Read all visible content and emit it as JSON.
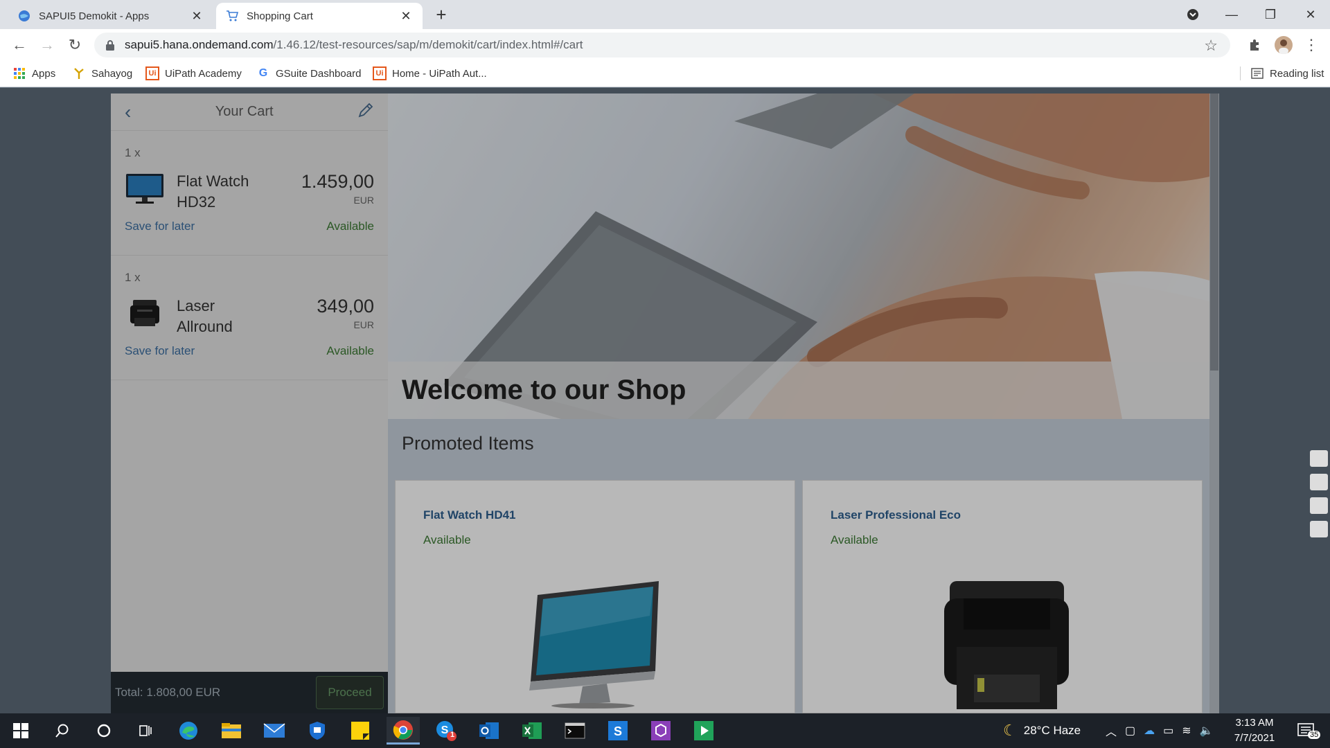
{
  "browser": {
    "tabs": [
      {
        "label": "SAPUI5 Demokit - Apps",
        "active": false
      },
      {
        "label": "Shopping Cart",
        "active": true
      }
    ],
    "url_host": "sapui5.hana.ondemand.com",
    "url_path": "/1.46.12/test-resources/sap/m/demokit/cart/index.html#/cart",
    "bookmarks": [
      "Apps",
      "Sahayog",
      "UiPath Academy",
      "GSuite Dashboard",
      "Home - UiPath Aut..."
    ],
    "reading_list": "Reading list"
  },
  "cart": {
    "title": "Your Cart",
    "items": [
      {
        "qty": "1 x",
        "name": "Flat Watch HD32",
        "price": "1.459,00",
        "currency": "EUR",
        "save_label": "Save for later",
        "status": "Available"
      },
      {
        "qty": "1 x",
        "name": "Laser Allround",
        "price": "349,00",
        "currency": "EUR",
        "save_label": "Save for later",
        "status": "Available"
      }
    ],
    "total": "Total: 1.808,00 EUR",
    "proceed_label": "Proceed"
  },
  "shop": {
    "welcome": "Welcome to our Shop",
    "promoted_title": "Promoted Items",
    "promoted": [
      {
        "name": "Flat Watch HD41",
        "status": "Available"
      },
      {
        "name": "Laser Professional Eco",
        "status": "Available"
      }
    ]
  },
  "taskbar": {
    "weather": "28°C Haze",
    "time": "3:13 AM",
    "date": "7/7/2021",
    "notifications": "35",
    "skype_badge": "1"
  },
  "colors": {
    "link": "#3c6fa3",
    "available": "#3c7a34",
    "title_link": "#2d5f8f"
  }
}
